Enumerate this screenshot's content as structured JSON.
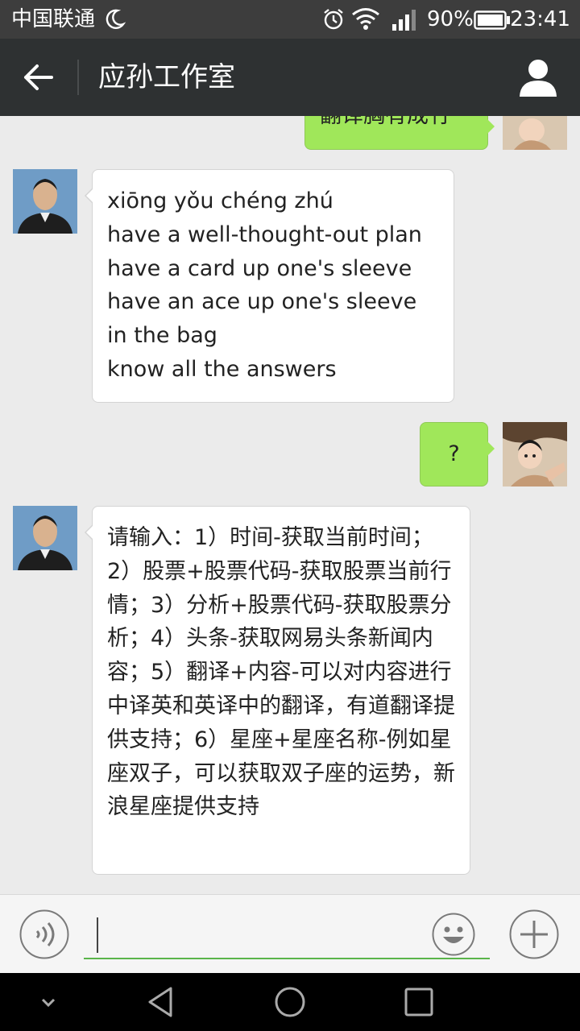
{
  "status_bar": {
    "carrier": "中国联通",
    "battery_percent": "90%",
    "time": "23:41",
    "icons": [
      "moon-icon",
      "alarm-icon",
      "wifi-icon",
      "signal-icon",
      "battery-icon"
    ]
  },
  "header": {
    "title": "应孙工作室",
    "back_icon": "arrow-left-icon",
    "profile_icon": "person-icon"
  },
  "messages": [
    {
      "sender": "me",
      "text": "翻译胸有成竹",
      "partial": true
    },
    {
      "sender": "contact",
      "text": "xiōng yǒu chéng zhú\nhave a well-thought-out plan\nhave a card up one's sleeve\nhave an ace up one's sleeve\nin the bag\nknow all the answers"
    },
    {
      "sender": "me",
      "text": "?"
    },
    {
      "sender": "contact",
      "text": "请输入：1）时间-获取当前时间；2）股票+股票代码-获取股票当前行情；3）分析+股票代码-获取股票分析；4）头条-获取网易头条新闻内容；5）翻译+内容-可以对内容进行中译英和英译中的翻译，有道翻译提供支持；6）星座+星座名称-例如星座双子，可以获取双子座的运势，新浪星座提供支持"
    }
  ],
  "input_bar": {
    "text_value": "",
    "voice_icon": "voice-icon",
    "emoji_icon": "emoji-icon",
    "plus_icon": "plus-icon"
  },
  "nav_bar": {
    "icons": [
      "collapse-icon",
      "back-triangle-icon",
      "home-circle-icon",
      "recents-square-icon"
    ]
  },
  "colors": {
    "title_bar": "#2e3132",
    "status_bar": "#3d3d3d",
    "outgoing_bubble": "#a0e75a",
    "incoming_bubble": "#ffffff",
    "chat_background": "#ebebeb",
    "input_underline": "#5ab54a"
  }
}
